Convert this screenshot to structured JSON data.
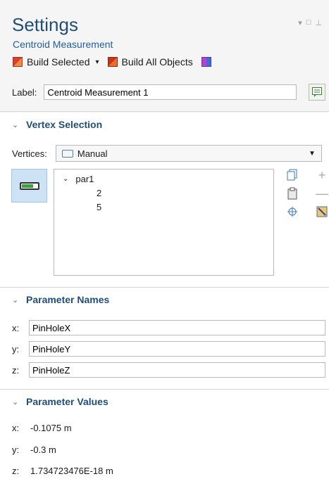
{
  "window": {
    "title": "Settings",
    "subtitle": "Centroid Measurement",
    "controls": {
      "dropdown": "▾",
      "restore": "□",
      "pin": "⊥"
    }
  },
  "toolbar": {
    "build_selected_label": "Build Selected",
    "build_selected_caret": "▾",
    "build_all_label": "Build All Objects"
  },
  "label_field": {
    "label": "Label:",
    "value": "Centroid Measurement 1"
  },
  "vertex_selection": {
    "heading": "Vertex Selection",
    "vertices_label": "Vertices:",
    "vertices_value": "Manual",
    "tree": {
      "root": "par1",
      "items": [
        "2",
        "5"
      ]
    },
    "tools": {
      "add": "+",
      "remove": "—"
    }
  },
  "parameter_names": {
    "heading": "Parameter Names",
    "rows": [
      {
        "label": "x:",
        "value": "PinHoleX"
      },
      {
        "label": "y:",
        "value": "PinHoleY"
      },
      {
        "label": "z:",
        "value": "PinHoleZ"
      }
    ]
  },
  "parameter_values": {
    "heading": "Parameter Values",
    "rows": [
      {
        "label": "x:",
        "value": "-0.1075 m"
      },
      {
        "label": "y:",
        "value": "-0.3 m"
      },
      {
        "label": "z:",
        "value": "1.734723476E-18 m"
      }
    ]
  },
  "colors": {
    "title": "#1f4e79",
    "section_heading": "#1f4e79",
    "toggle_bg": "#cde3f5"
  }
}
